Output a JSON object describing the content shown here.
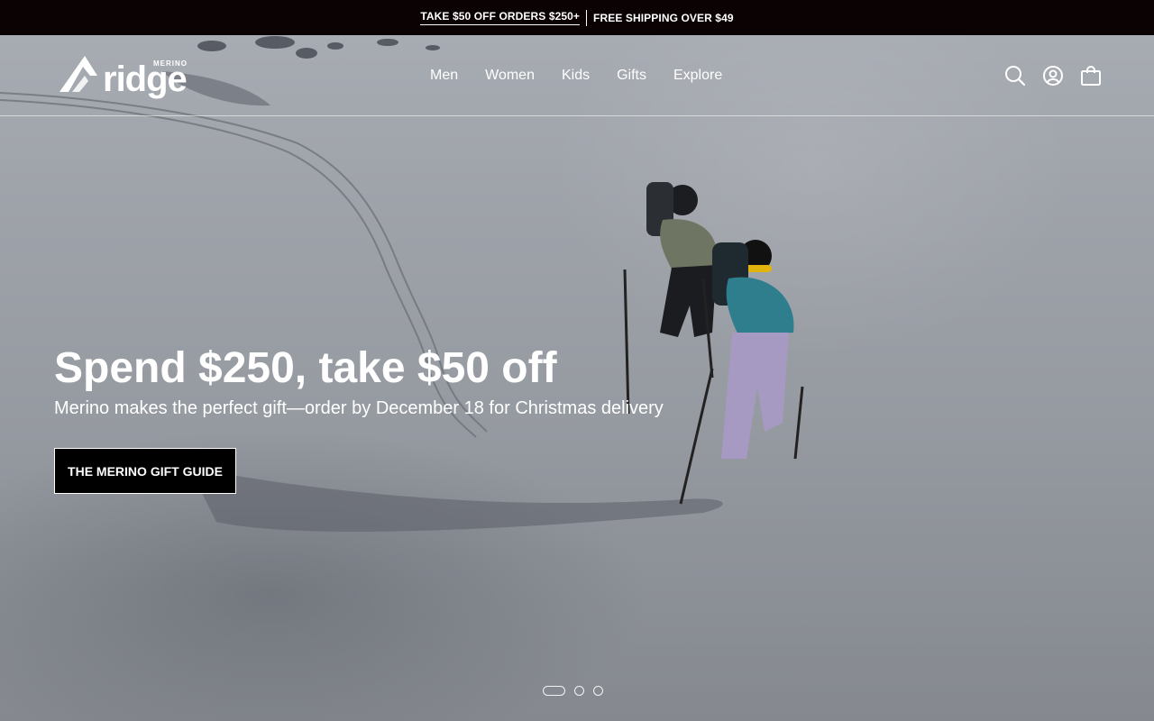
{
  "announcement": {
    "offer_link": "TAKE $50 OFF ORDERS $250+",
    "shipping": "FREE SHIPPING OVER $49"
  },
  "brand": {
    "name": "ridge",
    "tagline": "MERINO",
    "logo_icon": "mountain-icon"
  },
  "nav": {
    "items": [
      {
        "label": "Men"
      },
      {
        "label": "Women"
      },
      {
        "label": "Kids"
      },
      {
        "label": "Gifts"
      },
      {
        "label": "Explore"
      }
    ]
  },
  "header_icons": [
    "search-icon",
    "account-icon",
    "bag-icon"
  ],
  "hero": {
    "title": "Spend $250, take $50 off",
    "subtitle": "Merino makes the perfect gift—order by December 18 for Christmas delivery",
    "cta_label": "THE MERINO GIFT GUIDE",
    "slide_count": 3,
    "active_slide": 1
  },
  "colors": {
    "announcement_bg": "#0a0203",
    "cta_bg": "#000000",
    "text": "#ffffff"
  }
}
